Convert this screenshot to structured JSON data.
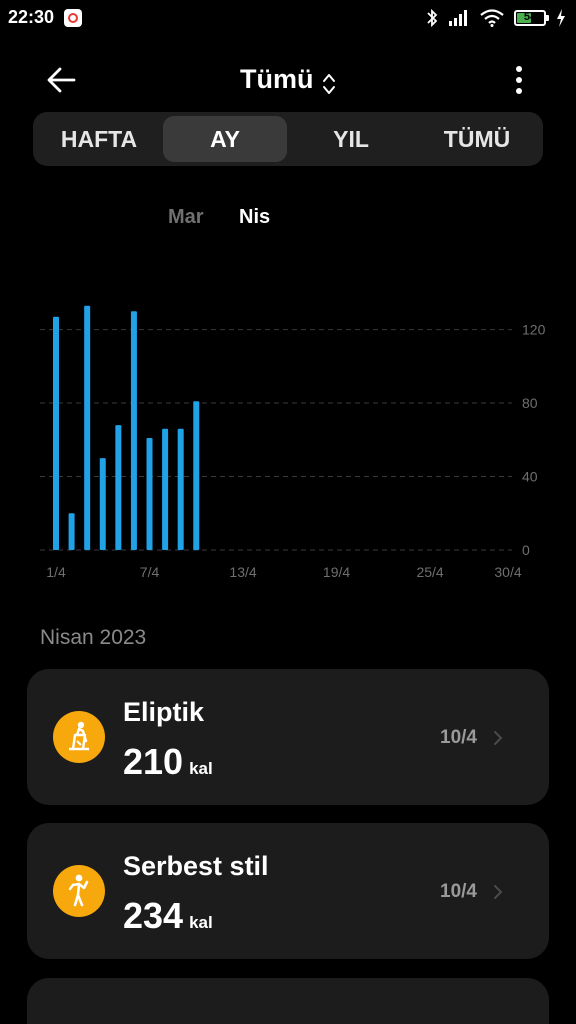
{
  "status_bar": {
    "time": "22:30",
    "battery_level": "54",
    "battery_fraction": 0.54,
    "battery_color": "#4caf50"
  },
  "header": {
    "title": "Tümü",
    "back_icon": "arrow-left-icon",
    "title_icon": "up-down-chevron-icon",
    "more_icon": "more-vertical-icon"
  },
  "tabs": [
    {
      "label": "HAFTA",
      "active": false
    },
    {
      "label": "AY",
      "active": true
    },
    {
      "label": "YIL",
      "active": false
    },
    {
      "label": "TÜMÜ",
      "active": false
    }
  ],
  "months": {
    "previous": "Mar",
    "current": "Nis"
  },
  "chart_data": {
    "type": "bar",
    "x": [
      "1/4",
      "2/4",
      "3/4",
      "4/4",
      "5/4",
      "6/4",
      "7/4",
      "8/4",
      "9/4",
      "10/4"
    ],
    "values": [
      127,
      20,
      133,
      50,
      68,
      130,
      61,
      66,
      66,
      81
    ],
    "x_tick_labels": [
      "1/4",
      "7/4",
      "13/4",
      "19/4",
      "25/4",
      "30/4"
    ],
    "y_tick_labels": [
      "120",
      "80",
      "40",
      "0"
    ],
    "y_ticks": [
      120,
      80,
      40,
      0
    ],
    "ylim": [
      0,
      140
    ],
    "x_range_days": 30,
    "bar_color": "#1fa2e8",
    "grid": true
  },
  "section_title": "Nisan 2023",
  "activities": [
    {
      "name": "Eliptik",
      "value": "210",
      "unit": "kal",
      "date": "10/4",
      "icon": "elliptical-icon",
      "icon_color": "#f7a80c"
    },
    {
      "name": "Serbest stil",
      "value": "234",
      "unit": "kal",
      "date": "10/4",
      "icon": "freestyle-person-icon",
      "icon_color": "#f7a80c"
    }
  ]
}
